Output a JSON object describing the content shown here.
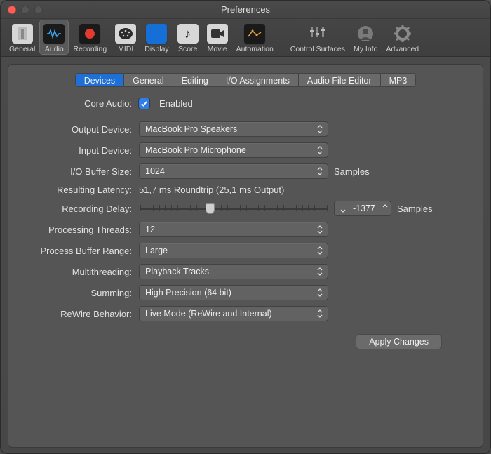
{
  "window": {
    "title": "Preferences"
  },
  "toolbar": [
    {
      "id": "general",
      "label": "General"
    },
    {
      "id": "audio",
      "label": "Audio",
      "active": true
    },
    {
      "id": "recording",
      "label": "Recording"
    },
    {
      "id": "midi",
      "label": "MIDI"
    },
    {
      "id": "display",
      "label": "Display"
    },
    {
      "id": "score",
      "label": "Score"
    },
    {
      "id": "movie",
      "label": "Movie"
    },
    {
      "id": "automation",
      "label": "Automation"
    },
    {
      "id": "controlsurfaces",
      "label": "Control Surfaces"
    },
    {
      "id": "myinfo",
      "label": "My Info"
    },
    {
      "id": "advanced",
      "label": "Advanced"
    }
  ],
  "tabs": [
    "Devices",
    "General",
    "Editing",
    "I/O Assignments",
    "Audio File Editor",
    "MP3"
  ],
  "active_tab": "Devices",
  "form": {
    "core_audio": {
      "label": "Core Audio:",
      "checkbox_label": "Enabled",
      "checked": true
    },
    "output": {
      "label": "Output Device:",
      "value": "MacBook Pro Speakers"
    },
    "input": {
      "label": "Input Device:",
      "value": "MacBook Pro Microphone"
    },
    "io_buffer": {
      "label": "I/O Buffer Size:",
      "value": "1024",
      "suffix": "Samples"
    },
    "latency": {
      "label": "Resulting Latency:",
      "value": "51,7 ms Roundtrip (25,1 ms Output)"
    },
    "rec_delay": {
      "label": "Recording Delay:",
      "value": "-1377",
      "suffix": "Samples",
      "slider_pos": 0.35
    },
    "threads": {
      "label": "Processing Threads:",
      "value": "12"
    },
    "pbr": {
      "label": "Process Buffer Range:",
      "value": "Large"
    },
    "mt": {
      "label": "Multithreading:",
      "value": "Playback Tracks"
    },
    "sum": {
      "label": "Summing:",
      "value": "High Precision (64 bit)"
    },
    "rewire": {
      "label": "ReWire Behavior:",
      "value": "Live Mode (ReWire and Internal)"
    }
  },
  "apply_label": "Apply Changes"
}
